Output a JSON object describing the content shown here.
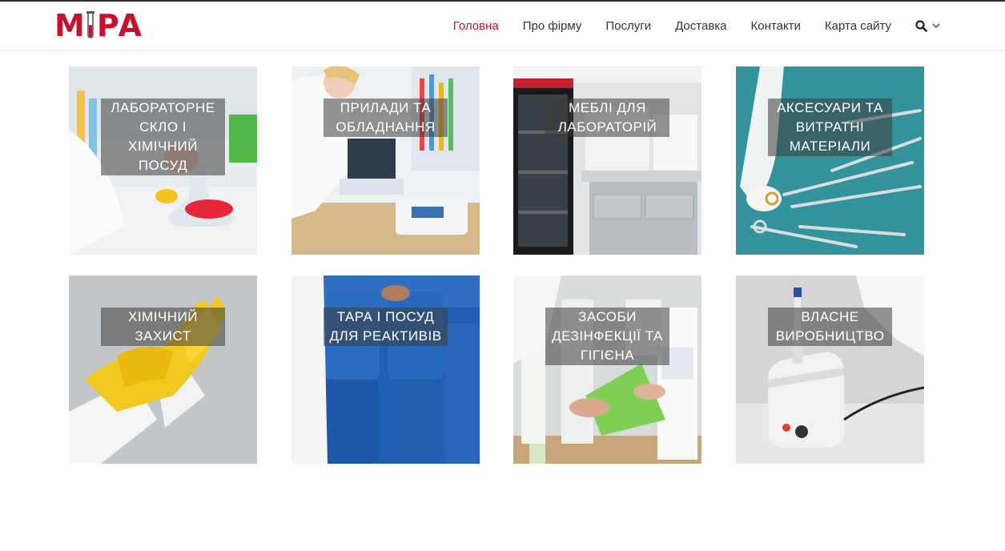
{
  "brand": {
    "logo_text_left": "M",
    "logo_text_right": "РА",
    "color": "#c8102e"
  },
  "nav": {
    "items": [
      {
        "label": "Головна",
        "active": true
      },
      {
        "label": "Про фірму",
        "active": false
      },
      {
        "label": "Послуги",
        "active": false
      },
      {
        "label": "Доставка",
        "active": false
      },
      {
        "label": "Контакти",
        "active": false
      },
      {
        "label": "Карта сайту",
        "active": false
      }
    ]
  },
  "categories": [
    {
      "label": "Лабораторне скло і хімічний посуд",
      "icon": "glassware-photo"
    },
    {
      "label": "Прилади та обладнання",
      "icon": "microscope-photo"
    },
    {
      "label": "Меблі для лабораторій",
      "icon": "lab-furniture-photo"
    },
    {
      "label": "Аксесуари та витратні матеріали",
      "icon": "surgical-tools-photo"
    },
    {
      "label": "Хімічний захист",
      "icon": "gloves-photo"
    },
    {
      "label": "Тара і посуд для реактивів",
      "icon": "canisters-photo"
    },
    {
      "label": "Засоби дезінфекції та гігієна",
      "icon": "disinfection-photo"
    },
    {
      "label": "Власне виробництво",
      "icon": "vortex-device-photo"
    }
  ]
}
